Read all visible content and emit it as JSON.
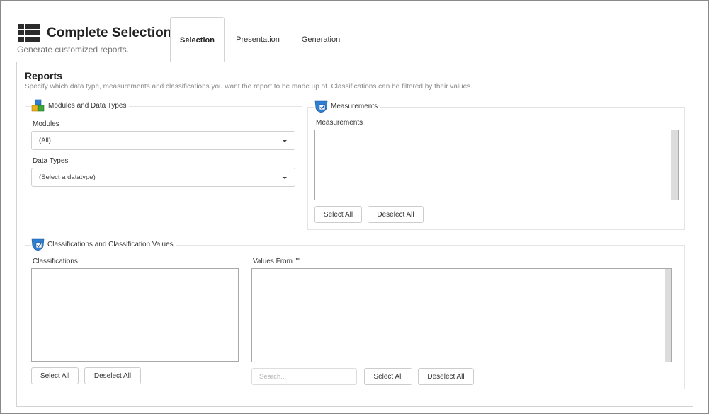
{
  "header": {
    "title": "Complete Selection",
    "subtitle": "Generate customized reports."
  },
  "tabs": [
    {
      "label": "Selection",
      "active": true
    },
    {
      "label": "Presentation",
      "active": false
    },
    {
      "label": "Generation",
      "active": false
    }
  ],
  "reports": {
    "title": "Reports",
    "description": "Specify which data type, measurements and classifications you want the report to be made up of. Classifications can be filtered by their values."
  },
  "modules_group": {
    "legend": "Modules and Data Types",
    "icon": "modules-cubes-icon",
    "modules_label": "Modules",
    "modules_value": "(All)",
    "datatypes_label": "Data Types",
    "datatypes_value": "(Select a datatype)"
  },
  "measurements_group": {
    "legend": "Measurements",
    "icon": "checked-shield-icon",
    "list_label": "Measurements",
    "select_all": "Select All",
    "deselect_all": "Deselect All"
  },
  "classifications_group": {
    "legend": "Classifications and Classification Values",
    "icon": "checked-shield-icon",
    "classifications_label": "Classifications",
    "values_label": "Values From \"\"",
    "select_all": "Select All",
    "deselect_all": "Deselect All",
    "search_placeholder": "Search...",
    "values_select_all": "Select All",
    "values_deselect_all": "Deselect All"
  },
  "colors": {
    "border": "#d3d3d3",
    "listbox_border": "#a9a9a9",
    "accent_blue": "#2f7fd1"
  }
}
